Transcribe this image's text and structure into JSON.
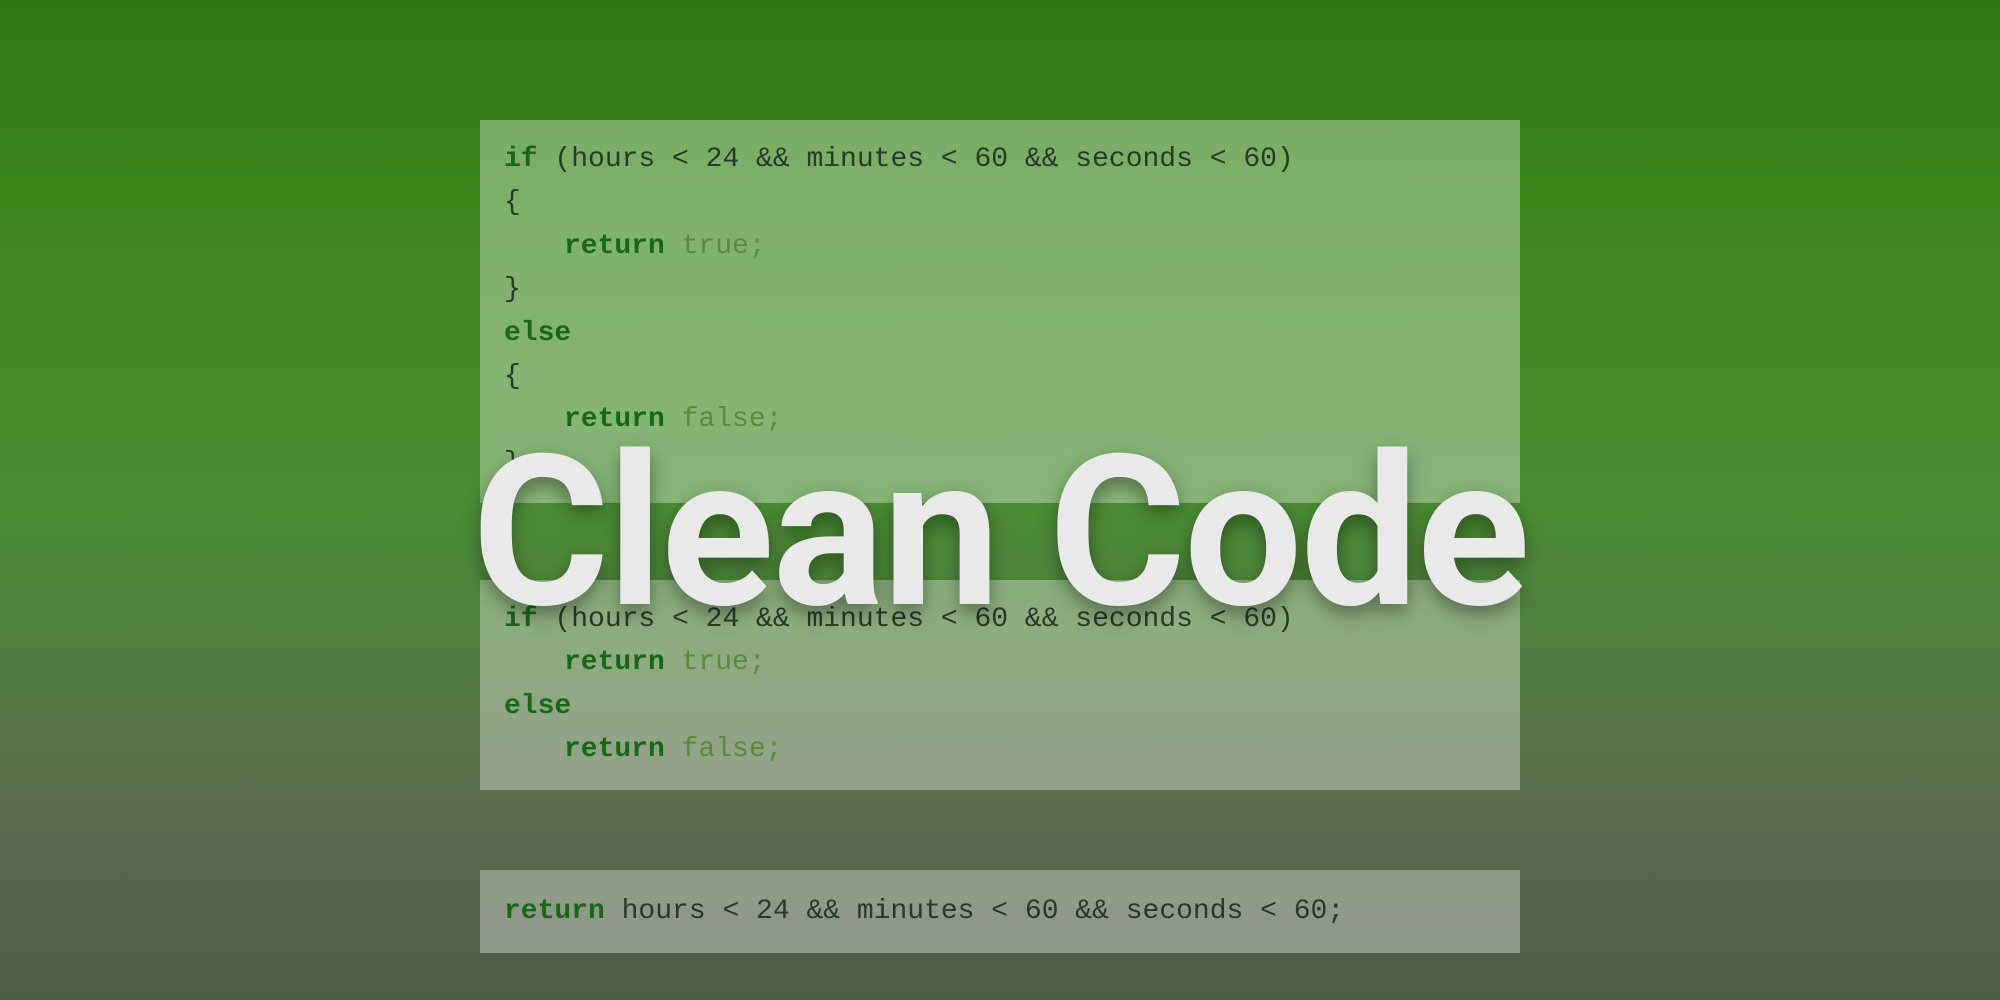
{
  "title": "Clean Code",
  "code": {
    "panel1": {
      "line1_if": "if",
      "line1_rest": " (hours < 24 && minutes < 60 && seconds < 60)",
      "line2": "{",
      "line3_return": "return",
      "line3_rest": " true;",
      "line4": "}",
      "line5_else": "else",
      "line6": "{",
      "line7_return": "return",
      "line7_rest": " false;",
      "line8": "}"
    },
    "panel2": {
      "line1_if": "if",
      "line1_rest": " (hours < 24 && minutes < 60 && seconds < 60)",
      "line2_return": "return",
      "line2_rest": " true;",
      "line3_else": "else",
      "line4_return": "return",
      "line4_rest": " false;"
    },
    "panel3": {
      "line1_return": "return",
      "line1_rest": " hours < 24 && minutes < 60 && seconds < 60;"
    }
  }
}
